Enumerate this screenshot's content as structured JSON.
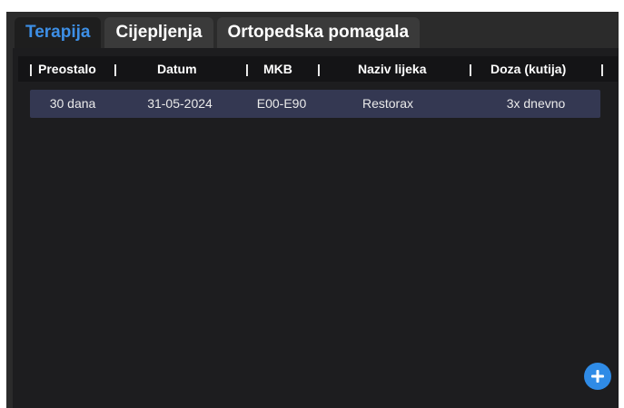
{
  "tabs": [
    {
      "label": "Terapija",
      "active": true
    },
    {
      "label": "Cijepljenja",
      "active": false
    },
    {
      "label": "Ortopedska pomagala",
      "active": false
    }
  ],
  "table": {
    "separator": "|",
    "columns": [
      "Preostalo",
      "Datum",
      "MKB",
      "Naziv lijeka",
      "Doza (kutija)"
    ],
    "rows": [
      {
        "preostalo": "30 dana",
        "datum": "31-05-2024",
        "mkb": "E00-E90",
        "naziv": "Restorax",
        "doza": "3x dnevno"
      }
    ]
  },
  "fab": {
    "icon": "plus-icon"
  },
  "colors": {
    "accent": "#3d8fe6",
    "row": "#343852",
    "fab": "#2f8be6"
  }
}
